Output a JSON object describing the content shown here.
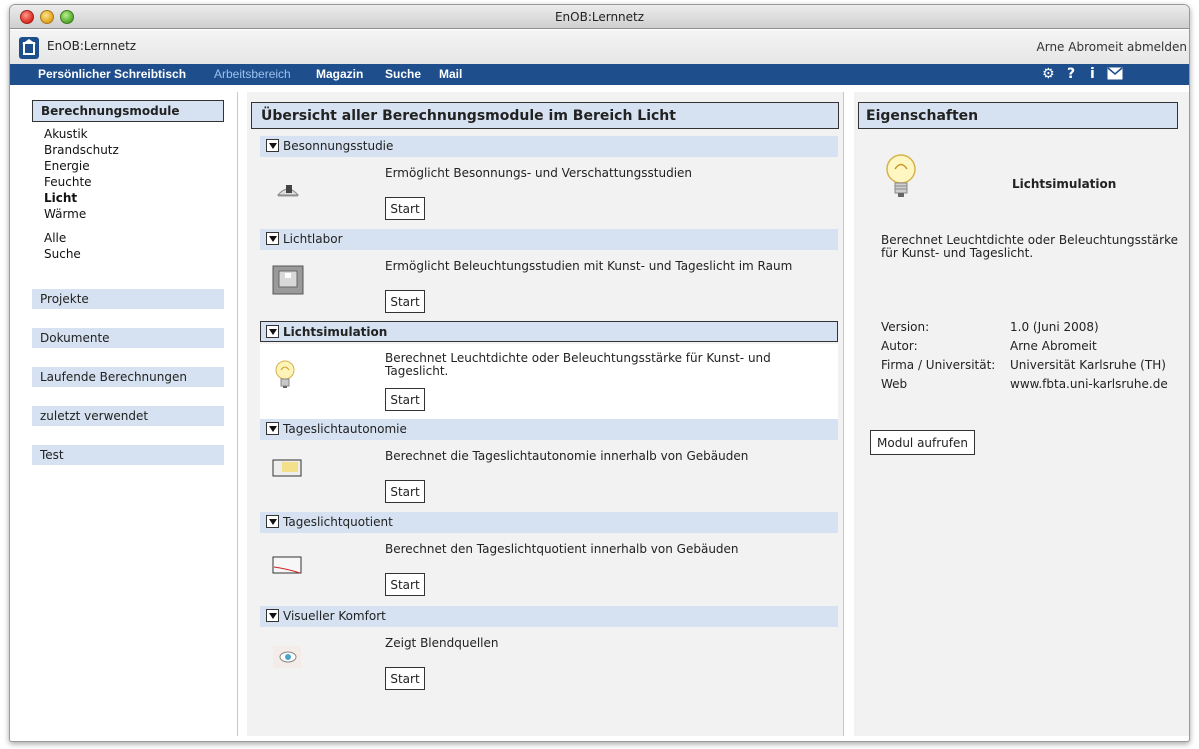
{
  "window": {
    "title": "EnOB:Lernnetz"
  },
  "header": {
    "app_name": "EnOB:Lernnetz",
    "user_logout": "Arne Abromeit abmelden"
  },
  "nav": {
    "items": [
      {
        "label": "Persönlicher Schreibtisch"
      },
      {
        "label": "Arbeitsbereich"
      },
      {
        "label": "Magazin"
      },
      {
        "label": "Suche"
      },
      {
        "label": "Mail"
      }
    ],
    "icons": [
      "gear-icon",
      "help-icon",
      "info-icon",
      "mail-icon"
    ]
  },
  "sidebar": {
    "heading": "Berechnungsmodule",
    "categories": [
      "Akustik",
      "Brandschutz",
      "Energie",
      "Feuchte",
      "Licht",
      "Wärme"
    ],
    "extra": [
      "Alle",
      "Suche"
    ],
    "sections": [
      "Projekte",
      "Dokumente",
      "Laufende Berechnungen",
      "zuletzt verwendet",
      "Test"
    ]
  },
  "main": {
    "title": "Übersicht aller Berechnungsmodule im Bereich Licht",
    "start_label": "Start",
    "modules": [
      {
        "name": "Besonnungsstudie",
        "desc": "Ermöglicht Besonnungs- und Verschattungsstudien",
        "icon": "sun-shade-icon"
      },
      {
        "name": "Lichtlabor",
        "desc": "Ermöglicht Beleuchtungsstudien mit Kunst- und Tageslicht im Raum",
        "icon": "room-icon"
      },
      {
        "name": "Lichtsimulation",
        "desc": "Berechnet Leuchtdichte oder Beleuchtungsstärke für Kunst- und Tageslicht.",
        "icon": "lightbulb-icon"
      },
      {
        "name": "Tageslichtautonomie",
        "desc": "Berechnet die Tageslichtautonomie innerhalb von Gebäuden",
        "icon": "daylight-autonomy-icon"
      },
      {
        "name": "Tageslichtquotient",
        "desc": "Berechnet den Tageslichtquotient innerhalb von Gebäuden",
        "icon": "daylight-factor-icon"
      },
      {
        "name": "Visueller Komfort",
        "desc": "Zeigt Blendquellen",
        "icon": "eye-icon"
      }
    ]
  },
  "properties": {
    "title": "Eigenschaften",
    "name": "Lichtsimulation",
    "desc": "Berechnet Leuchtdichte oder Beleuchtungsstärke für Kunst- und Tageslicht.",
    "rows": [
      {
        "k": "Version:",
        "v": "1.0 (Juni 2008)"
      },
      {
        "k": "Autor:",
        "v": "Arne Abromeit"
      },
      {
        "k": "Firma / Universität:",
        "v": "Universität Karlsruhe (TH)"
      },
      {
        "k": "Web",
        "v": "www.fbta.uni-karlsruhe.de"
      }
    ],
    "button": "Modul aufrufen"
  }
}
